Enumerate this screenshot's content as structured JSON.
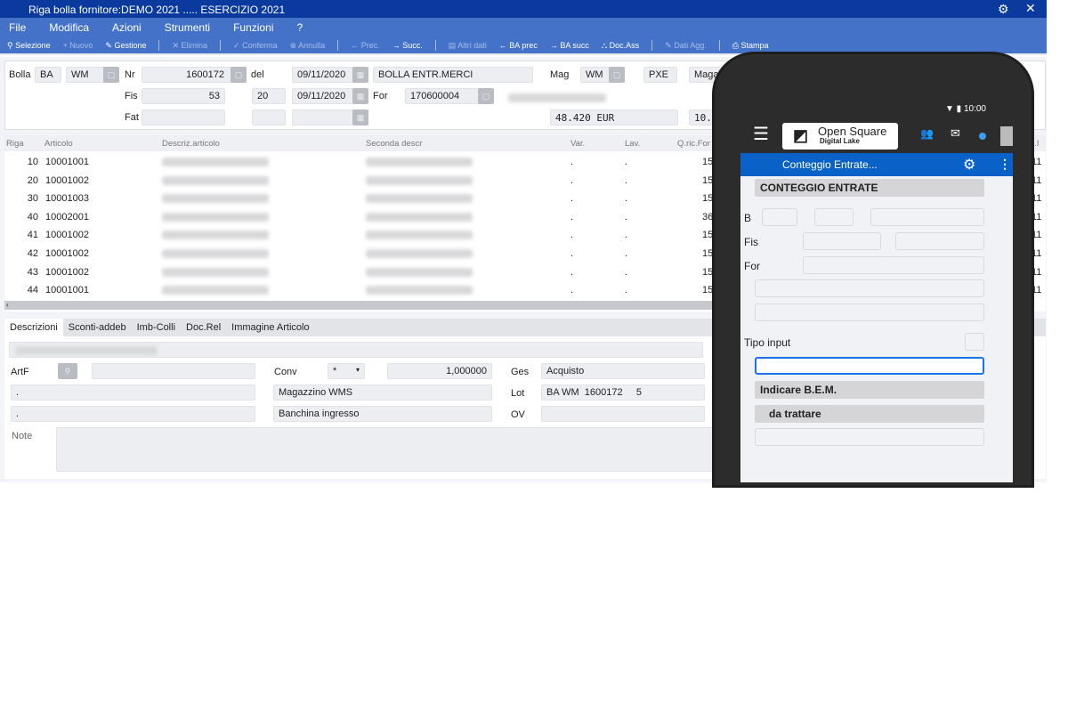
{
  "window": {
    "title": "Riga bolla fornitore:DEMO 2021 ..... ESERCIZIO 2021"
  },
  "menu": [
    "File",
    "Modifica",
    "Azioni",
    "Strumenti",
    "Funzioni",
    "?"
  ],
  "toolbar": [
    {
      "label": "Selezione",
      "icon": "search-icon",
      "enabled": true
    },
    {
      "label": "Nuovo",
      "icon": "plus-icon",
      "enabled": false
    },
    {
      "label": "Gestione",
      "icon": "pencil-icon",
      "enabled": true
    },
    {
      "label": "Elimina",
      "icon": "x-icon",
      "enabled": false
    },
    {
      "label": "Conferma",
      "icon": "check-icon",
      "enabled": false
    },
    {
      "label": "Annulla",
      "icon": "cancel-icon",
      "enabled": false
    },
    {
      "label": "Prec.",
      "icon": "arrow-left-icon",
      "enabled": false
    },
    {
      "label": "Succ.",
      "icon": "arrow-right-icon",
      "enabled": true
    },
    {
      "label": "Altri dati",
      "icon": "panel-icon",
      "enabled": false
    },
    {
      "label": "BA prec",
      "icon": "arrow-left-icon",
      "enabled": true
    },
    {
      "label": "BA succ",
      "icon": "arrow-right-icon",
      "enabled": true
    },
    {
      "label": "Doc.Ass",
      "icon": "binoculars-icon",
      "enabled": true
    },
    {
      "label": "Dati Agg.",
      "icon": "pencil-icon",
      "enabled": false
    },
    {
      "label": "Stampa",
      "icon": "printer-icon",
      "enabled": true
    }
  ],
  "header": {
    "bolla_label": "Bolla",
    "bolla": "BA",
    "serie": "WM",
    "nr_label": "Nr",
    "nr": "1600172",
    "del_label": "del",
    "del": "09/11/2020",
    "causale": "BOLLA ENTR.MERCI",
    "mag_label": "Mag",
    "mag": "WM",
    "mag2": "PXE",
    "mag_desc": "Maga",
    "fis_label": "Fis",
    "fis": "53",
    "fis2": "20",
    "fis_date": "09/11/2020",
    "for_label": "For",
    "for": "170600004",
    "fat_label": "Fat",
    "amount": "48.420 EUR",
    "amount2": "10.1"
  },
  "grid": {
    "columns": [
      "Riga",
      "Articolo",
      "Descriz.articolo",
      "Seconda descr",
      "Var.",
      "Lav.",
      "Q.ric.For",
      "d.I"
    ],
    "rows": [
      {
        "riga": "10",
        "articolo": "10001001",
        "var": ".",
        "lav": ".",
        "q": "15",
        "d": "11"
      },
      {
        "riga": "20",
        "articolo": "10001002",
        "var": ".",
        "lav": ".",
        "q": "15",
        "d": "11"
      },
      {
        "riga": "30",
        "articolo": "10001003",
        "var": ".",
        "lav": ".",
        "q": "15",
        "d": "11"
      },
      {
        "riga": "40",
        "articolo": "10002001",
        "var": ".",
        "lav": ".",
        "q": "36",
        "d": "11"
      },
      {
        "riga": "41",
        "articolo": "10001002",
        "var": ".",
        "lav": ".",
        "q": "15",
        "d": "11"
      },
      {
        "riga": "42",
        "articolo": "10001002",
        "var": ".",
        "lav": ".",
        "q": "15",
        "d": "11"
      },
      {
        "riga": "43",
        "articolo": "10001002",
        "var": ".",
        "lav": ".",
        "q": "15",
        "d": "11"
      },
      {
        "riga": "44",
        "articolo": "10001001",
        "var": ".",
        "lav": ".",
        "q": "15",
        "d": "11"
      }
    ]
  },
  "tabs": [
    "Descrizioni",
    "Sconti-addeb",
    "Imb-Colli",
    "Doc.Rel",
    "Immagine Articolo"
  ],
  "detail": {
    "artf_label": "ArtF",
    "conv_label": "Conv",
    "conv": "*",
    "factor": "1,000000",
    "ges_label": "Ges",
    "ges": "Acquisto",
    "dot1": ".",
    "dot2": ".",
    "magazzino": "Magazzino WMS",
    "lot_label": "Lot",
    "lot": "BA WM  1600172     5",
    "banchina": "Banchina ingresso",
    "ov_label": "OV",
    "note_label": "Note"
  },
  "phone": {
    "time": "10:00",
    "logo_line1": "Open Square",
    "logo_line2": "Digital Lake",
    "screen_title": "Conteggio Entrate...",
    "section": "CONTEGGIO ENTRATE",
    "b_label": "B",
    "fis_label": "Fis",
    "for_label": "For",
    "tipo_label": "Tipo input",
    "msg1": "Indicare B.E.M.",
    "msg2": "da trattare"
  },
  "colors": {
    "title_bar": "#0b3a9e",
    "menu_bar": "#4472c9",
    "phone_accent": "#0a62c9"
  }
}
